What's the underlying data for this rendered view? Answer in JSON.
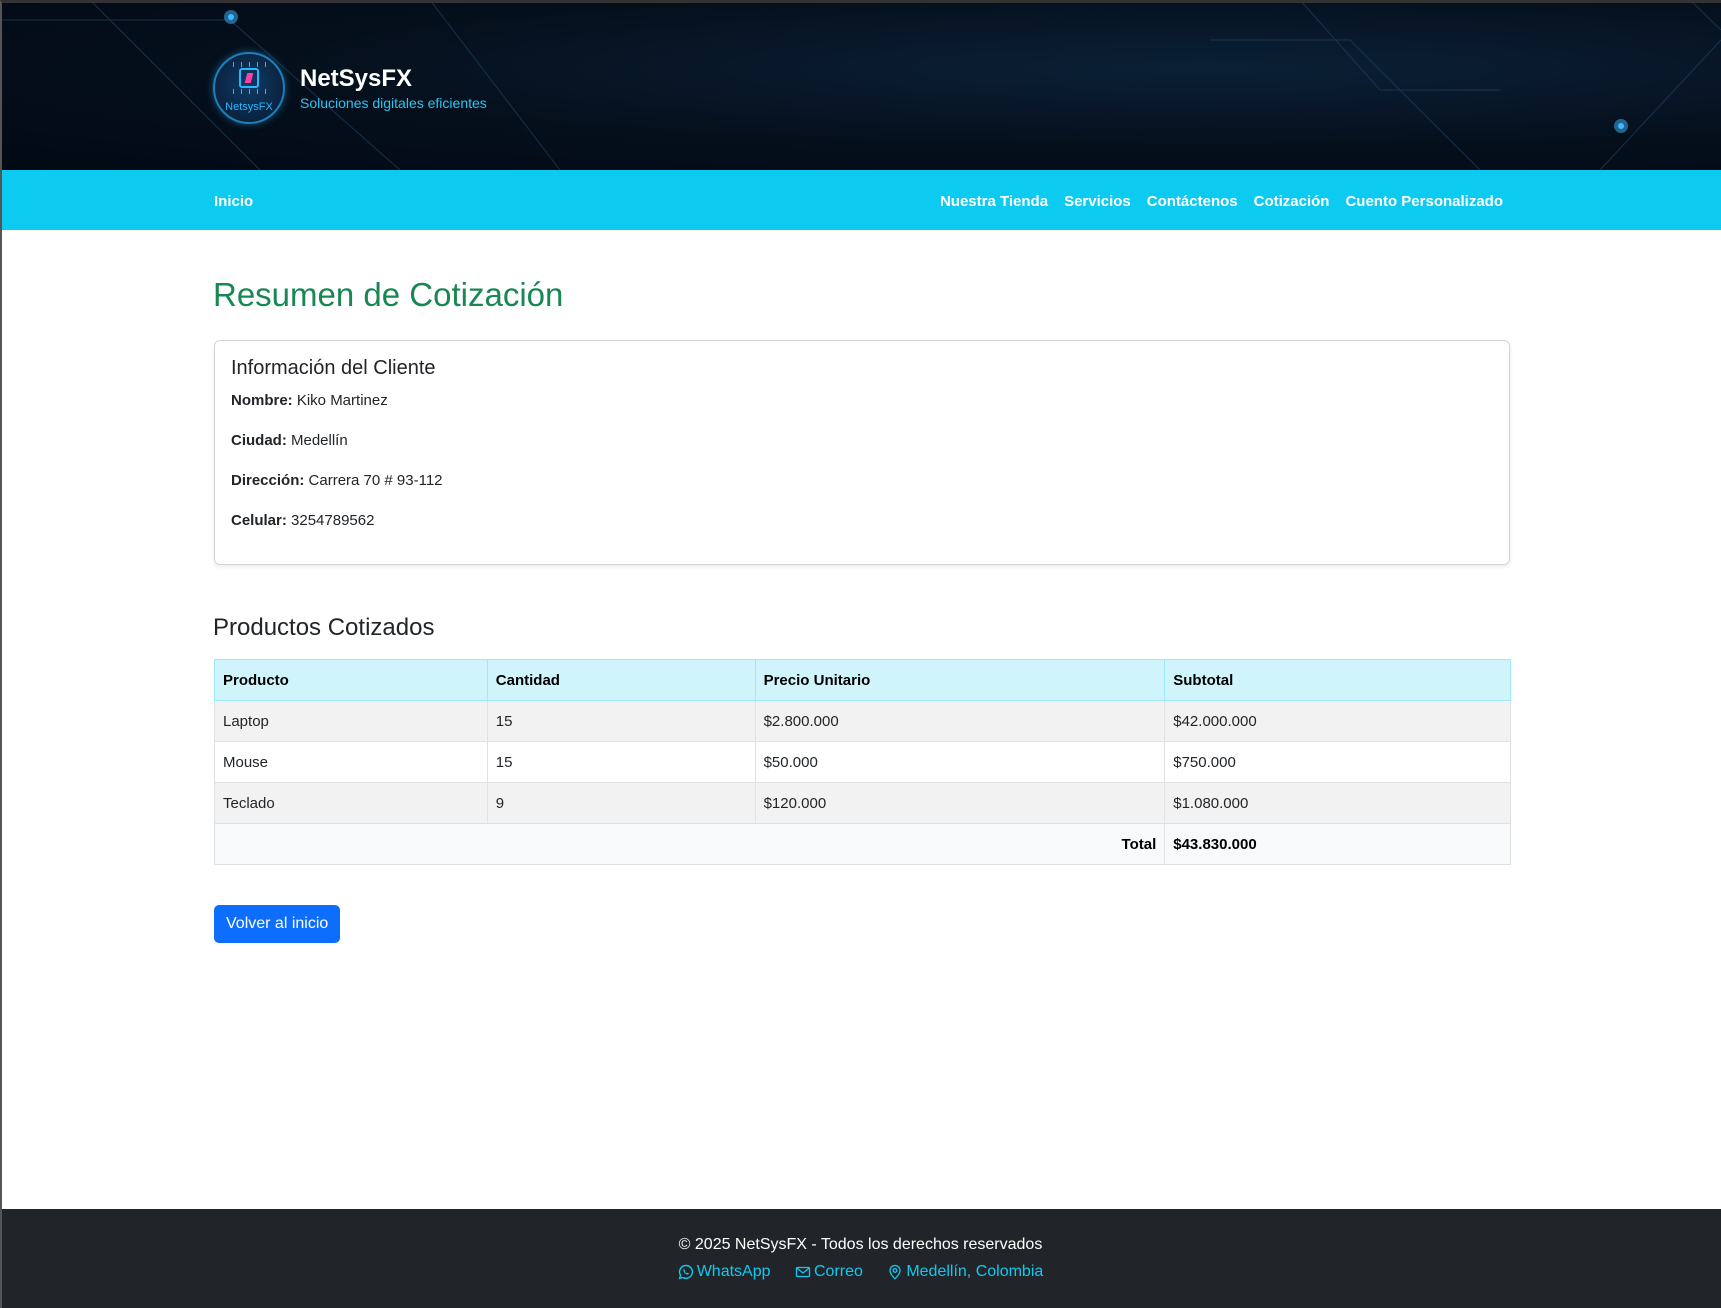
{
  "brand": {
    "logo_text": "NetsysFX",
    "title": "NetSysFX",
    "subtitle": "Soluciones digitales eficientes"
  },
  "nav": {
    "home": "Inicio",
    "items": [
      "Nuestra Tienda",
      "Servicios",
      "Contáctenos",
      "Cotización",
      "Cuento Personalizado"
    ]
  },
  "main": {
    "title": "Resumen de Cotización",
    "client": {
      "heading": "Información del Cliente",
      "name_label": "Nombre:",
      "name": "Kiko Martinez",
      "city_label": "Ciudad:",
      "city": "Medellín",
      "address_label": "Dirección:",
      "address": "Carrera 70 # 93-112",
      "phone_label": "Celular:",
      "phone": "3254789562"
    },
    "products": {
      "heading": "Productos Cotizados",
      "columns": [
        "Producto",
        "Cantidad",
        "Precio Unitario",
        "Subtotal"
      ],
      "rows": [
        [
          "Laptop",
          "15",
          "$2.800.000",
          "$42.000.000"
        ],
        [
          "Mouse",
          "15",
          "$50.000",
          "$750.000"
        ],
        [
          "Teclado",
          "9",
          "$120.000",
          "$1.080.000"
        ]
      ],
      "total_label": "Total",
      "total_value": "$43.830.000"
    },
    "back_button": "Volver al inicio"
  },
  "footer": {
    "copyright": "© 2025 NetSysFX - Todos los derechos reservados",
    "links": [
      "WhatsApp",
      "Correo",
      "Medellín, Colombia"
    ]
  },
  "colors": {
    "header_bg": "#020913",
    "nav_bg": "#0dcaf0",
    "title_green": "#198754",
    "table_head": "#cff4fc",
    "primary_button": "#0d6efd",
    "footer_bg": "#212529",
    "footer_link": "#0dcaf0"
  },
  "icons": [
    "whatsapp-icon",
    "envelope-icon",
    "location-pin-icon"
  ]
}
